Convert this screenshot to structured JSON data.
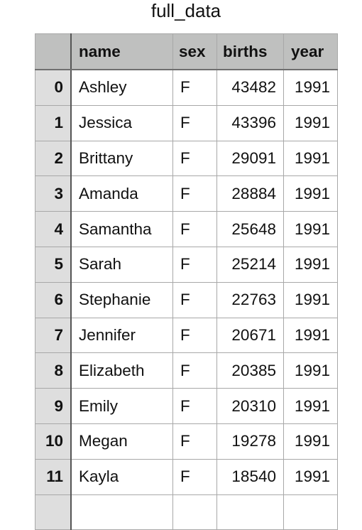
{
  "title": "full_data",
  "table": {
    "columns": [
      "",
      "name",
      "sex",
      "births",
      "year"
    ],
    "rows": [
      {
        "index": "0",
        "name": "Ashley",
        "sex": "F",
        "births": "43482",
        "year": "1991"
      },
      {
        "index": "1",
        "name": "Jessica",
        "sex": "F",
        "births": "43396",
        "year": "1991"
      },
      {
        "index": "2",
        "name": "Brittany",
        "sex": "F",
        "births": "29091",
        "year": "1991"
      },
      {
        "index": "3",
        "name": "Amanda",
        "sex": "F",
        "births": "28884",
        "year": "1991"
      },
      {
        "index": "4",
        "name": "Samantha",
        "sex": "F",
        "births": "25648",
        "year": "1991"
      },
      {
        "index": "5",
        "name": "Sarah",
        "sex": "F",
        "births": "25214",
        "year": "1991"
      },
      {
        "index": "6",
        "name": "Stephanie",
        "sex": "F",
        "births": "22763",
        "year": "1991"
      },
      {
        "index": "7",
        "name": "Jennifer",
        "sex": "F",
        "births": "20671",
        "year": "1991"
      },
      {
        "index": "8",
        "name": "Elizabeth",
        "sex": "F",
        "births": "20385",
        "year": "1991"
      },
      {
        "index": "9",
        "name": "Emily",
        "sex": "F",
        "births": "20310",
        "year": "1991"
      },
      {
        "index": "10",
        "name": "Megan",
        "sex": "F",
        "births": "19278",
        "year": "1991"
      },
      {
        "index": "11",
        "name": "Kayla",
        "sex": "F",
        "births": "18540",
        "year": "1991"
      },
      {
        "index": "",
        "name": "",
        "sex": "",
        "births": "",
        "year": ""
      }
    ]
  }
}
